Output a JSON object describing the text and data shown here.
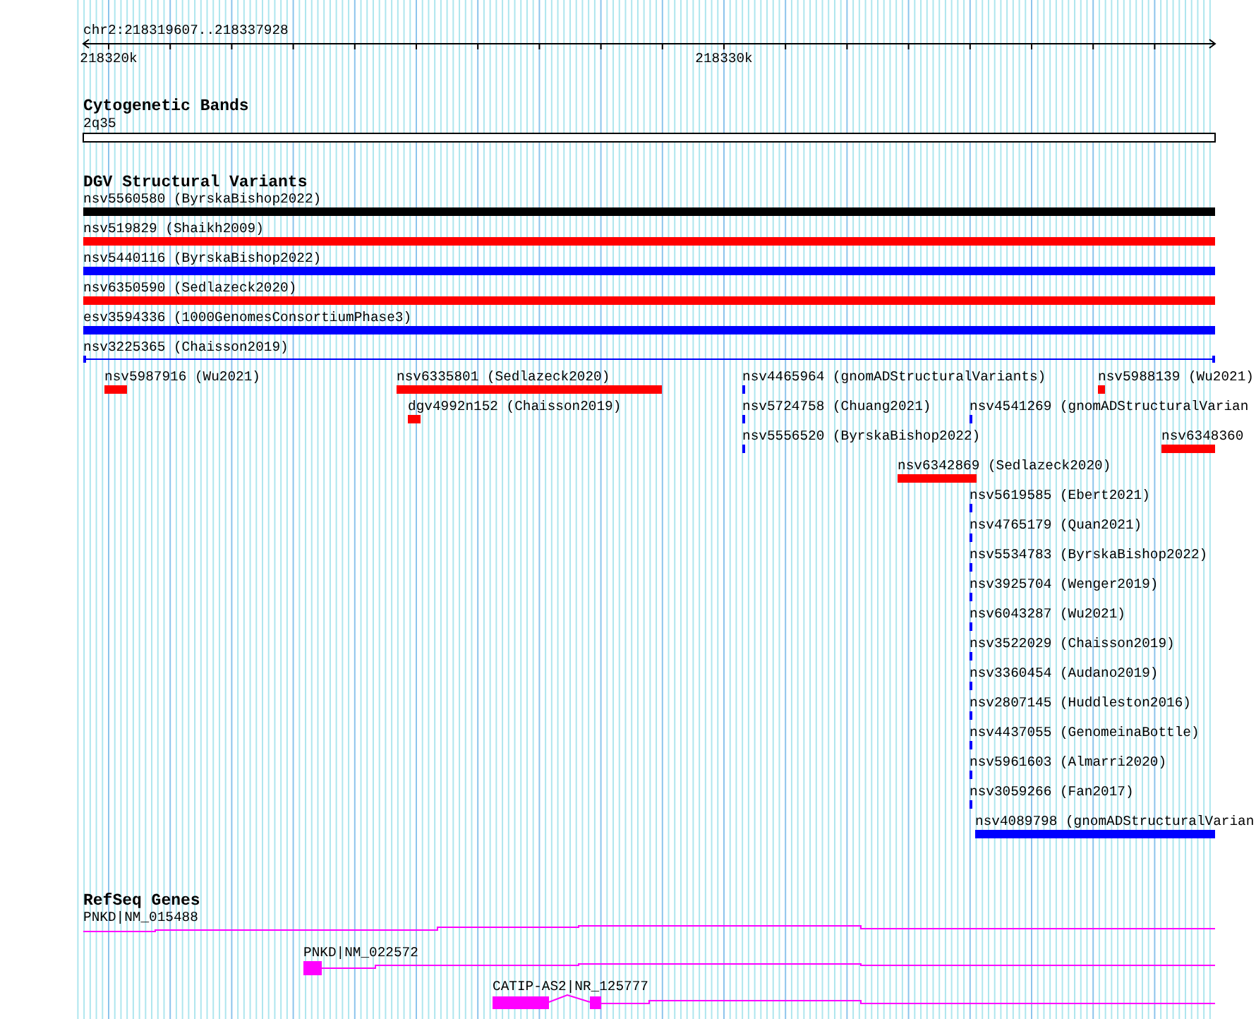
{
  "location": "chr2:218319607..218337928",
  "ruler": {
    "ticks": [
      "218320k",
      "218330k"
    ]
  },
  "tracks": [
    {
      "title": "Cytogenetic Bands",
      "kind": "cytoband",
      "features": [
        {
          "label": "2q35"
        }
      ]
    },
    {
      "title": "DGV Structural Variants",
      "kind": "variants",
      "features": [
        {
          "label": "nsv5560580 (ByrskaBishop2022)",
          "kind": "bar",
          "color": "#000000"
        },
        {
          "label": "nsv519829 (Shaikh2009)",
          "kind": "bar",
          "color": "#ff0000"
        },
        {
          "label": "nsv5440116 (ByrskaBishop2022)",
          "kind": "bar",
          "color": "#0000ff"
        },
        {
          "label": "nsv6350590 (Sedlazeck2020)",
          "kind": "bar",
          "color": "#ff0000"
        },
        {
          "label": "esv3594336 (1000GenomesConsortiumPhase3)",
          "kind": "bar",
          "color": "#0000ff"
        },
        {
          "label": "nsv3225365 (Chaisson2019)",
          "kind": "line",
          "color": "#0000ff"
        },
        {
          "label": "nsv5987916 (Wu2021)",
          "kind": "bar",
          "color": "#ff0000"
        },
        {
          "label": "nsv6335801 (Sedlazeck2020)",
          "kind": "bar",
          "color": "#ff0000"
        },
        {
          "label": "nsv4465964 (gnomADStructuralVariants)",
          "kind": "bar",
          "color": "#0000ff"
        },
        {
          "label": "nsv5988139 (Wu2021)",
          "kind": "bar",
          "color": "#ff0000"
        },
        {
          "label": "dgv4992n152 (Chaisson2019)",
          "kind": "bar",
          "color": "#ff0000"
        },
        {
          "label": "nsv5724758 (Chuang2021)",
          "kind": "bar",
          "color": "#0000ff"
        },
        {
          "label": "nsv4541269 (gnomADStructuralVarian",
          "kind": "bar",
          "color": "#0000ff"
        },
        {
          "label": "nsv5556520 (ByrskaBishop2022)",
          "kind": "bar",
          "color": "#0000ff"
        },
        {
          "label": "nsv6348360",
          "kind": "bar",
          "color": "#ff0000"
        },
        {
          "label": "nsv6342869 (Sedlazeck2020)",
          "kind": "bar",
          "color": "#ff0000"
        },
        {
          "label": "nsv5619585 (Ebert2021)",
          "kind": "bar",
          "color": "#0000ff"
        },
        {
          "label": "nsv4765179 (Quan2021)",
          "kind": "bar",
          "color": "#0000ff"
        },
        {
          "label": "nsv5534783 (ByrskaBishop2022)",
          "kind": "bar",
          "color": "#0000ff"
        },
        {
          "label": "nsv3925704 (Wenger2019)",
          "kind": "bar",
          "color": "#0000ff"
        },
        {
          "label": "nsv6043287 (Wu2021)",
          "kind": "bar",
          "color": "#0000ff"
        },
        {
          "label": "nsv3522029 (Chaisson2019)",
          "kind": "bar",
          "color": "#0000ff"
        },
        {
          "label": "nsv3360454 (Audano2019)",
          "kind": "bar",
          "color": "#0000ff"
        },
        {
          "label": "nsv2807145 (Huddleston2016)",
          "kind": "bar",
          "color": "#0000ff"
        },
        {
          "label": "nsv4437055 (GenomeinaBottle)",
          "kind": "bar",
          "color": "#0000ff"
        },
        {
          "label": "nsv5961603 (Almarri2020)",
          "kind": "bar",
          "color": "#0000ff"
        },
        {
          "label": "nsv3059266 (Fan2017)",
          "kind": "bar",
          "color": "#0000ff"
        },
        {
          "label": "nsv4089798 (gnomADStructuralVarian",
          "kind": "bar",
          "color": "#0000ff"
        }
      ]
    },
    {
      "title": "RefSeq Genes",
      "kind": "genes",
      "features": [
        {
          "label": "PNKD|NM_015488"
        },
        {
          "label": "PNKD|NM_022572"
        },
        {
          "label": "CATIP-AS2|NR_125777"
        }
      ]
    }
  ]
}
